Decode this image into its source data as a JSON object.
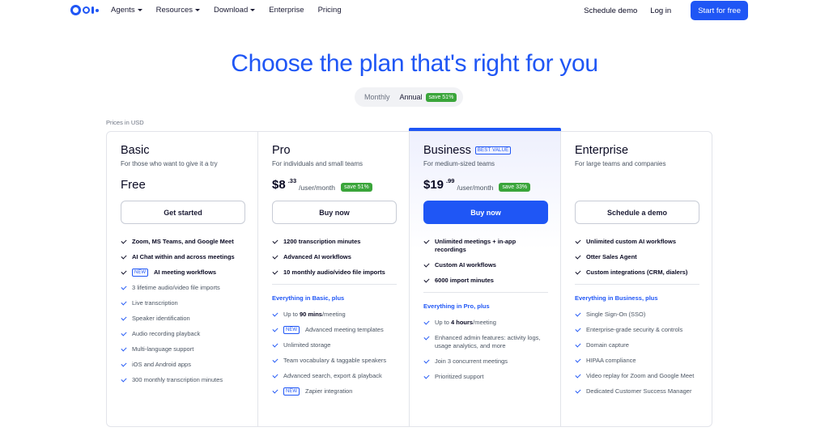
{
  "nav": {
    "links": [
      {
        "label": "Agents",
        "dropdown": true
      },
      {
        "label": "Resources",
        "dropdown": true
      },
      {
        "label": "Download",
        "dropdown": true
      },
      {
        "label": "Enterprise",
        "dropdown": false
      },
      {
        "label": "Pricing",
        "dropdown": false
      }
    ],
    "schedule_demo": "Schedule demo",
    "login": "Log in",
    "start_free": "Start for free"
  },
  "hero": {
    "title": "Choose the plan that's right for you"
  },
  "billing_toggle": {
    "monthly": "Monthly",
    "annual": "Annual",
    "annual_save": "save 51%",
    "selected": "Annual"
  },
  "prices_in": "Prices in USD",
  "colors": {
    "brand": "#1f56f5",
    "save_green": "#3aa53a"
  },
  "plans": [
    {
      "name": "Basic",
      "desc": "For those who want to give it a try",
      "price_text": "Free",
      "cta": "Get started",
      "features": [
        {
          "text": "Zoom, MS Teams, and Google Meet",
          "bold": true
        },
        {
          "text": "AI Chat within and across meetings",
          "bold": true
        },
        {
          "text": "AI meeting workflows",
          "bold": true,
          "tag": "NEW"
        },
        {
          "text": "3 lifetime audio/video file imports"
        },
        {
          "text": "Live transcription"
        },
        {
          "text": "Speaker identification"
        },
        {
          "text": "Audio recording playback"
        },
        {
          "text": "Multi-language support"
        },
        {
          "text": "iOS and Android apps"
        },
        {
          "text": "300 monthly transcription minutes"
        }
      ]
    },
    {
      "name": "Pro",
      "desc": "For individuals and small teams",
      "price_dollars": "$8",
      "price_cents": ".33",
      "price_unit": "/user/month",
      "save": "save 51%",
      "cta": "Buy now",
      "features": [
        {
          "text": "1200 transcription minutes",
          "bold": true
        },
        {
          "text": "Advanced AI workflows",
          "bold": true
        },
        {
          "text": "10 monthly audio/video file imports",
          "bold": true
        }
      ],
      "section_label": "Everything in Basic, plus",
      "more_features": [
        {
          "pre": "Up to ",
          "strong": "90 mins",
          "post": "/meeting"
        },
        {
          "text": "Advanced meeting templates",
          "tag": "NEW"
        },
        {
          "text": "Unlimited storage"
        },
        {
          "text": "Team vocabulary & taggable speakers"
        },
        {
          "text": "Advanced search, export & playback"
        },
        {
          "text": "Zapier integration",
          "tag": "NEW"
        }
      ]
    },
    {
      "name": "Business",
      "badge": "BEST VALUE",
      "desc": "For medium-sized teams",
      "price_dollars": "$19",
      "price_cents": ".99",
      "price_unit": "/user/month",
      "save": "save 33%",
      "cta": "Buy now",
      "features": [
        {
          "text": "Unlimited meetings + in-app recordings",
          "bold": true
        },
        {
          "text": "Custom AI workflows",
          "bold": true
        },
        {
          "text": "6000 import minutes",
          "bold": true
        }
      ],
      "section_label": "Everything in Pro, plus",
      "more_features": [
        {
          "pre": "Up to ",
          "strong": "4 hours",
          "post": "/meeting"
        },
        {
          "text": "Enhanced admin features: activity logs, usage analytics, and more"
        },
        {
          "text": "Join 3 concurrent meetings"
        },
        {
          "text": "Prioritized support"
        }
      ]
    },
    {
      "name": "Enterprise",
      "desc": "For large teams and companies",
      "cta": "Schedule a demo",
      "features": [
        {
          "text": "Unlimited custom AI workflows",
          "bold": true
        },
        {
          "text": "Otter Sales Agent",
          "bold": true
        },
        {
          "text": "Custom integrations (CRM, dialers)",
          "bold": true
        }
      ],
      "section_label": "Everything in Business, plus",
      "more_features": [
        {
          "text": "Single Sign-On (SSO)"
        },
        {
          "text": "Enterprise-grade security & controls"
        },
        {
          "text": "Domain capture"
        },
        {
          "text": "HIPAA compliance"
        },
        {
          "text": "Video replay for Zoom and Google Meet"
        },
        {
          "text": "Dedicated Customer Success Manager"
        }
      ]
    }
  ]
}
